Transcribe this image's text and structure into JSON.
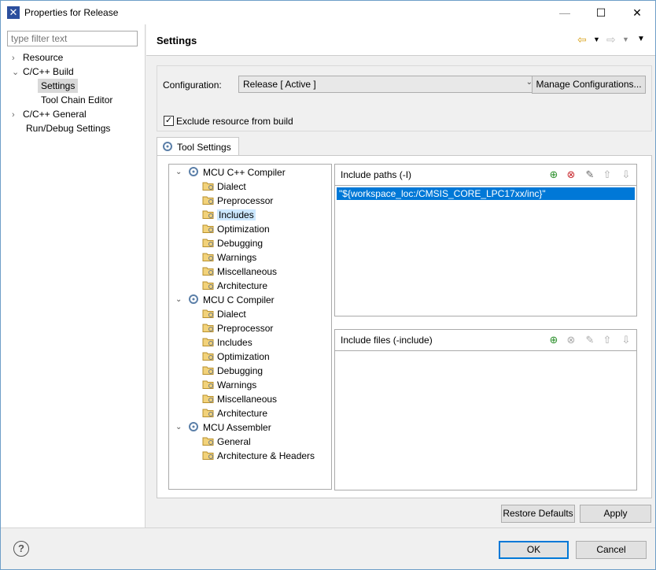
{
  "window": {
    "title": "Properties for Release"
  },
  "left": {
    "filter_placeholder": "type filter text",
    "items": [
      {
        "label": "Resource"
      },
      {
        "label": "C/C++ Build"
      },
      {
        "label": "Settings"
      },
      {
        "label": "Tool Chain Editor"
      },
      {
        "label": "C/C++ General"
      },
      {
        "label": "Run/Debug Settings"
      }
    ]
  },
  "header": {
    "title": "Settings"
  },
  "config": {
    "label": "Configuration:",
    "value": "Release  [ Active ]",
    "manage_label": "Manage Configurations...",
    "exclude_label": "Exclude resource from build",
    "exclude_checked": true
  },
  "tab": {
    "label": "Tool Settings"
  },
  "tree": {
    "groups": [
      {
        "label": "MCU C++ Compiler",
        "children": [
          "Dialect",
          "Preprocessor",
          "Includes",
          "Optimization",
          "Debugging",
          "Warnings",
          "Miscellaneous",
          "Architecture"
        ]
      },
      {
        "label": "MCU C Compiler",
        "children": [
          "Dialect",
          "Preprocessor",
          "Includes",
          "Optimization",
          "Debugging",
          "Warnings",
          "Miscellaneous",
          "Architecture"
        ]
      },
      {
        "label": "MCU Assembler",
        "children": [
          "General",
          "Architecture & Headers"
        ]
      }
    ],
    "selected": "Includes"
  },
  "include_paths": {
    "title": "Include paths (-I)",
    "items": [
      "\"${workspace_loc:/CMSIS_CORE_LPC17xx/inc}\""
    ]
  },
  "include_files": {
    "title": "Include files (-include)",
    "items": []
  },
  "buttons": {
    "restore_defaults": "Restore Defaults",
    "apply": "Apply",
    "ok": "OK",
    "cancel": "Cancel"
  },
  "colors": {
    "selection": "#0078d7",
    "tree_selection": "#cce8ff",
    "app_icon": "#2c4f9e"
  }
}
